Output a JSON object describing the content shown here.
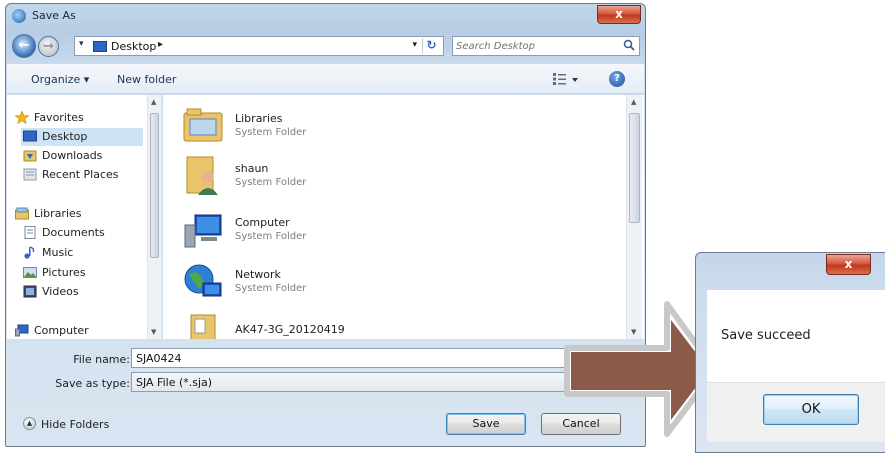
{
  "save_as": {
    "title": "Save As",
    "close_label": "x",
    "address": {
      "location": "Desktop",
      "separator": "▸"
    },
    "search": {
      "placeholder": "Search Desktop"
    },
    "toolbar": {
      "organize_label": "Organize ▾",
      "new_folder_label": "New folder",
      "help_label": "?"
    },
    "nav": {
      "items": [
        {
          "label": "Favorites",
          "icon": "star-icon"
        },
        {
          "label": "Desktop",
          "icon": "desktop-icon",
          "selected": true
        },
        {
          "label": "Downloads",
          "icon": "downloads-icon"
        },
        {
          "label": "Recent Places",
          "icon": "recent-places-icon"
        },
        {
          "label": "Libraries",
          "icon": "libraries-icon"
        },
        {
          "label": "Documents",
          "icon": "documents-icon"
        },
        {
          "label": "Music",
          "icon": "music-icon"
        },
        {
          "label": "Pictures",
          "icon": "pictures-icon"
        },
        {
          "label": "Videos",
          "icon": "videos-icon"
        },
        {
          "label": "Computer",
          "icon": "computer-icon"
        }
      ]
    },
    "files": [
      {
        "name": "Libraries",
        "type": "System Folder",
        "icon": "libraries-folder-icon"
      },
      {
        "name": "shaun",
        "type": "System Folder",
        "icon": "user-folder-icon"
      },
      {
        "name": "Computer",
        "type": "System Folder",
        "icon": "computer-icon"
      },
      {
        "name": "Network",
        "type": "System Folder",
        "icon": "network-icon"
      },
      {
        "name": "AK47-3G_20120419",
        "type": "",
        "icon": "folder-icon"
      }
    ],
    "file_name": {
      "label": "File name:",
      "value": "SJA0424"
    },
    "save_as_type": {
      "label": "Save as type:",
      "value": "SJA File (*.sja)"
    },
    "hide_folders_label": "Hide Folders",
    "save_label": "Save",
    "cancel_label": "Cancel"
  },
  "message_box": {
    "close_label": "x",
    "message": "Save succeed",
    "ok_label": "OK"
  },
  "colors": {
    "arrow": "#8b5a49",
    "arrow_outline": "#c8c8c8",
    "selection": "#cfe3f7",
    "close_red": "#c1361c"
  }
}
